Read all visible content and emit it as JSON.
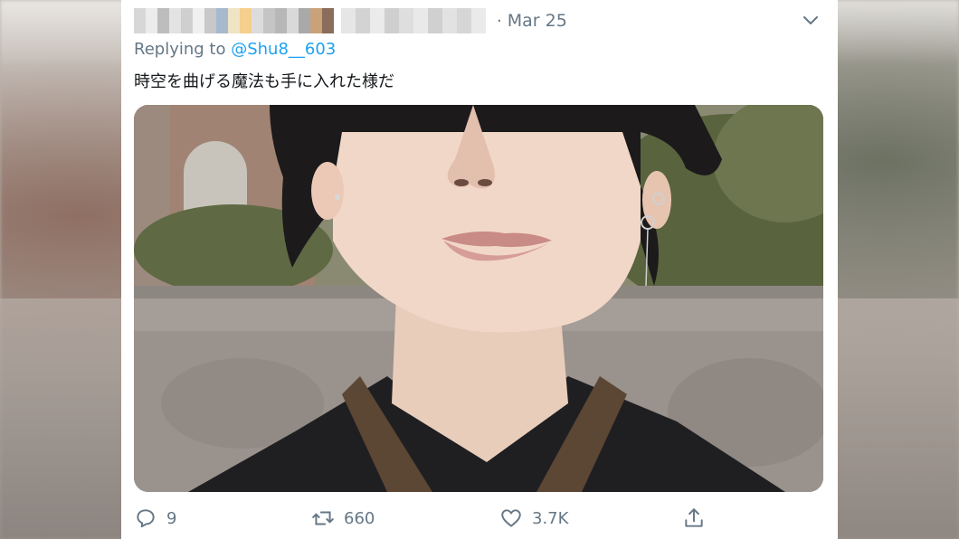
{
  "tweet": {
    "date_sep": "·",
    "date": "Mar 25",
    "reply_prefix": "Replying to ",
    "reply_handle": "@Shu8__603",
    "text": "時空を曲げる魔法も手に入れた様だ"
  },
  "actions": {
    "reply_count": "9",
    "retweet_count": "660",
    "like_count": "3.7K"
  },
  "icons": {
    "more": "chevron-down-icon",
    "reply": "reply-icon",
    "retweet": "retweet-icon",
    "like": "heart-icon",
    "share": "share-icon"
  },
  "colors": {
    "link": "#1da1f2",
    "muted": "#657786",
    "text": "#14171a"
  }
}
